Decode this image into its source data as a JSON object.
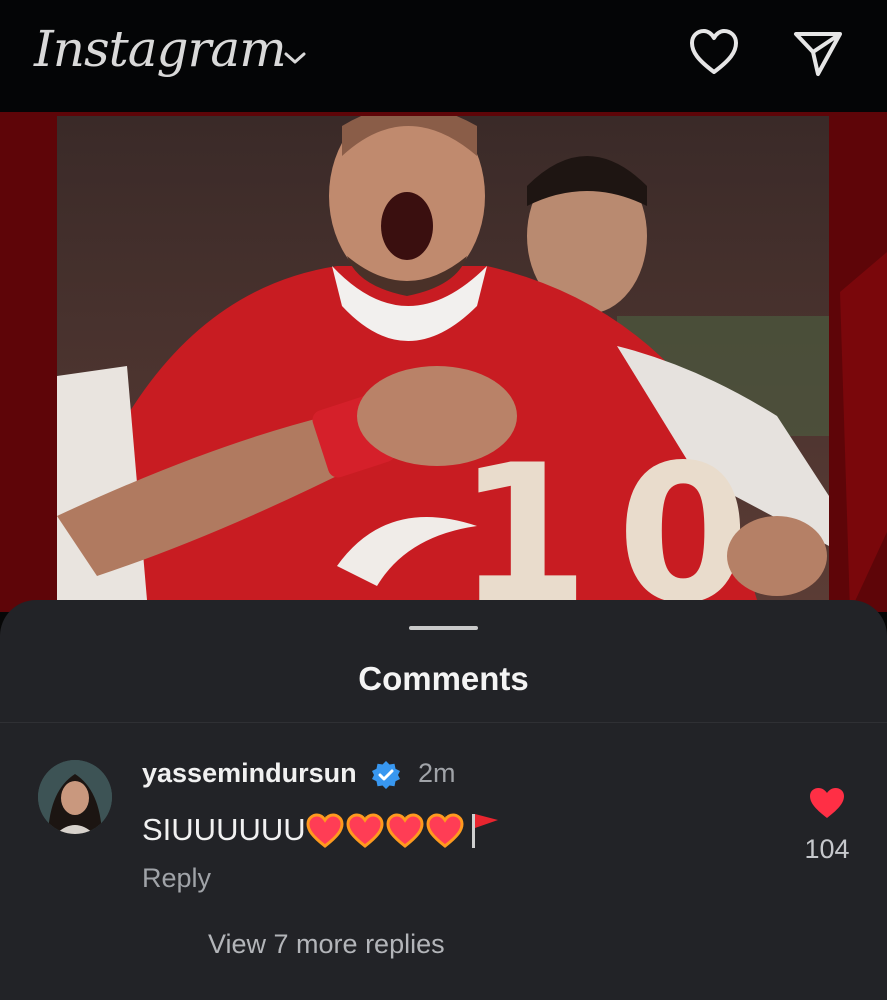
{
  "header": {
    "logo_text": "Instagram",
    "account_switcher_icon": "chevron-down-icon",
    "notifications_icon": "heart-outline-icon",
    "direct_icon": "paper-plane-icon"
  },
  "post": {
    "image_description_icon": "photo",
    "accent_color": "#b01217"
  },
  "comments_sheet": {
    "title": "Comments",
    "comments": [
      {
        "username": "yassemindursun",
        "verified": true,
        "time": "2m",
        "text": "SIUUUUUU",
        "emojis": [
          "heart-on-fire-icon",
          "heart-on-fire-icon",
          "heart-on-fire-icon",
          "heart-on-fire-icon",
          "triangular-flag-icon"
        ],
        "reply_label": "Reply",
        "like_count": "104",
        "liked": true,
        "view_replies_label": "View 7 more replies"
      }
    ]
  },
  "colors": {
    "background": "#070707",
    "sheet": "#222327",
    "like_red": "#ff2f45",
    "verified_blue": "#3897f0",
    "muted_text": "#a0a3a8"
  }
}
